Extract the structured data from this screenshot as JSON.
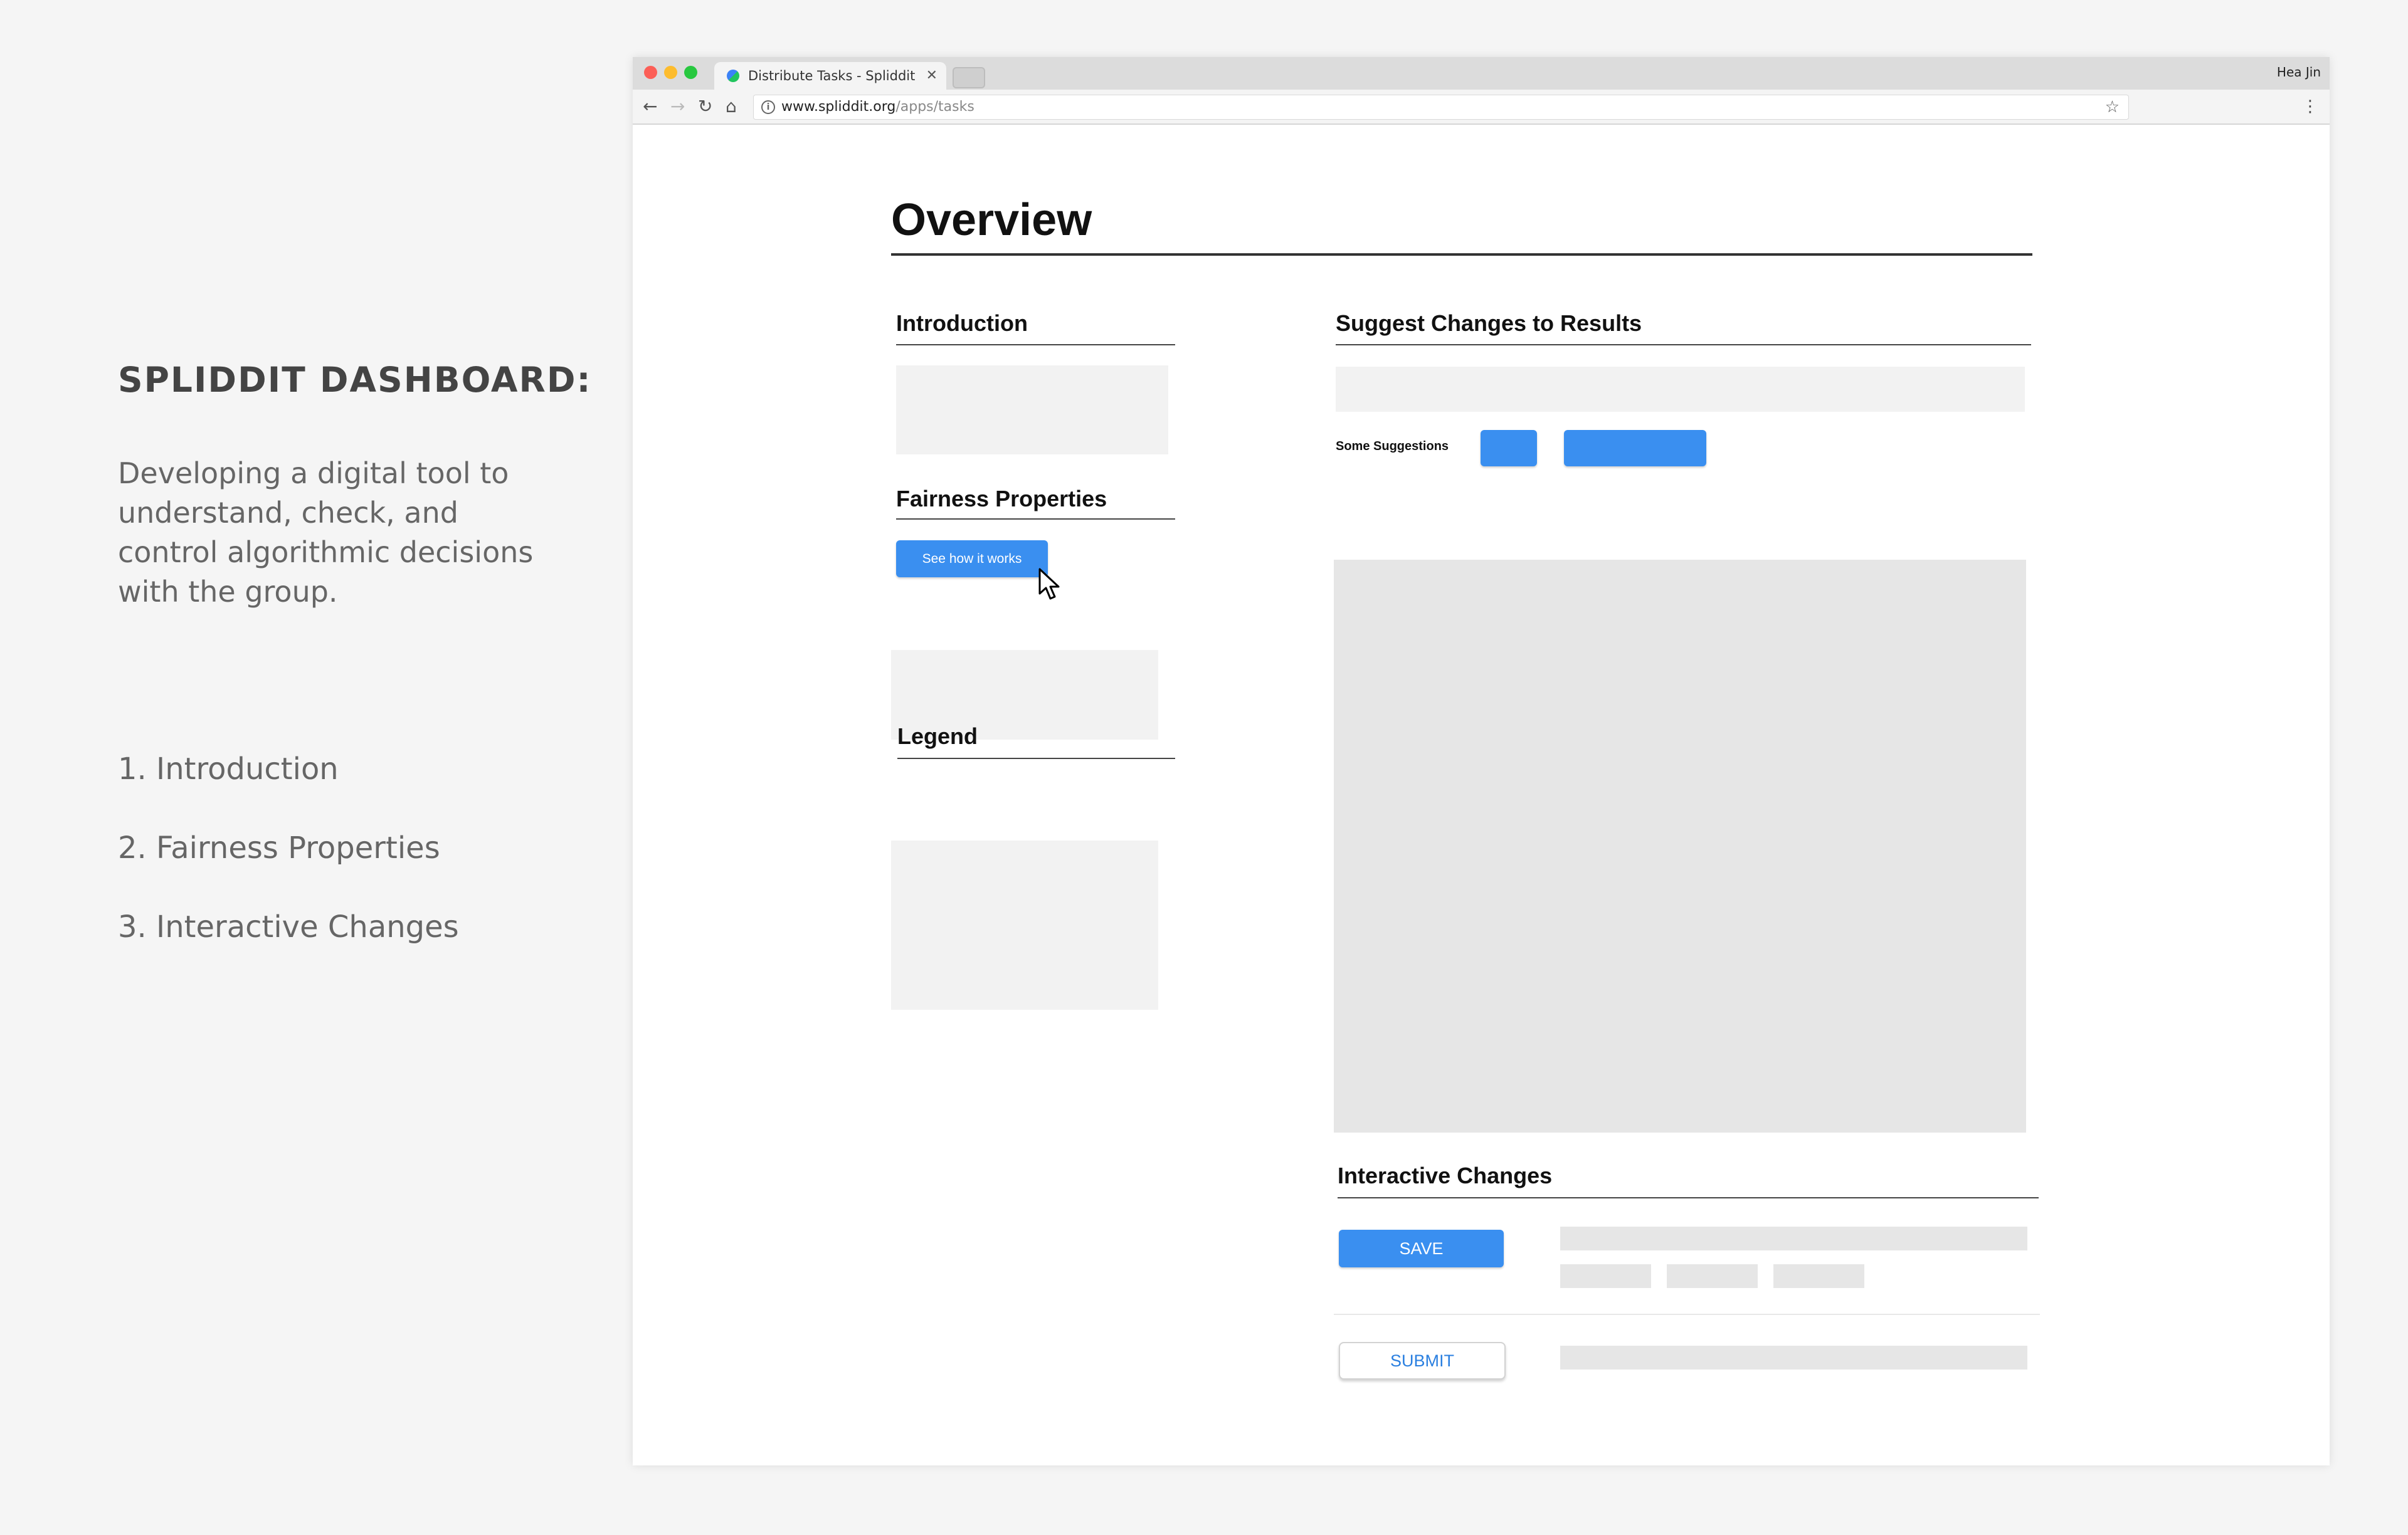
{
  "sidebar": {
    "title": "SPLIDDIT DASHBOARD:",
    "description": "Developing a digital tool to understand, check, and control algorithmic decisions with the group.",
    "items": [
      {
        "label": "1. Introduction"
      },
      {
        "label": "2. Fairness Properties"
      },
      {
        "label": "3. Interactive Changes"
      }
    ]
  },
  "browser": {
    "tab_title": "Distribute Tasks - Spliddit",
    "profile_name": "Hea Jin",
    "url_domain": "www.spliddit.org",
    "url_path": "/apps/tasks"
  },
  "page": {
    "title": "Overview",
    "introduction": {
      "heading": "Introduction"
    },
    "fairness": {
      "heading": "Fairness Properties",
      "button_label": "See how it works"
    },
    "legend": {
      "heading": "Legend"
    },
    "suggest": {
      "heading": "Suggest Changes to Results",
      "suggestions_label": "Some Suggestions"
    },
    "interactive": {
      "heading": "Interactive Changes",
      "save_label": "SAVE",
      "submit_label": "SUBMIT"
    }
  },
  "colors": {
    "accent": "#3a8ff0",
    "placeholder": "#f2f2f2",
    "placeholder_dark": "#e6e6e6"
  }
}
